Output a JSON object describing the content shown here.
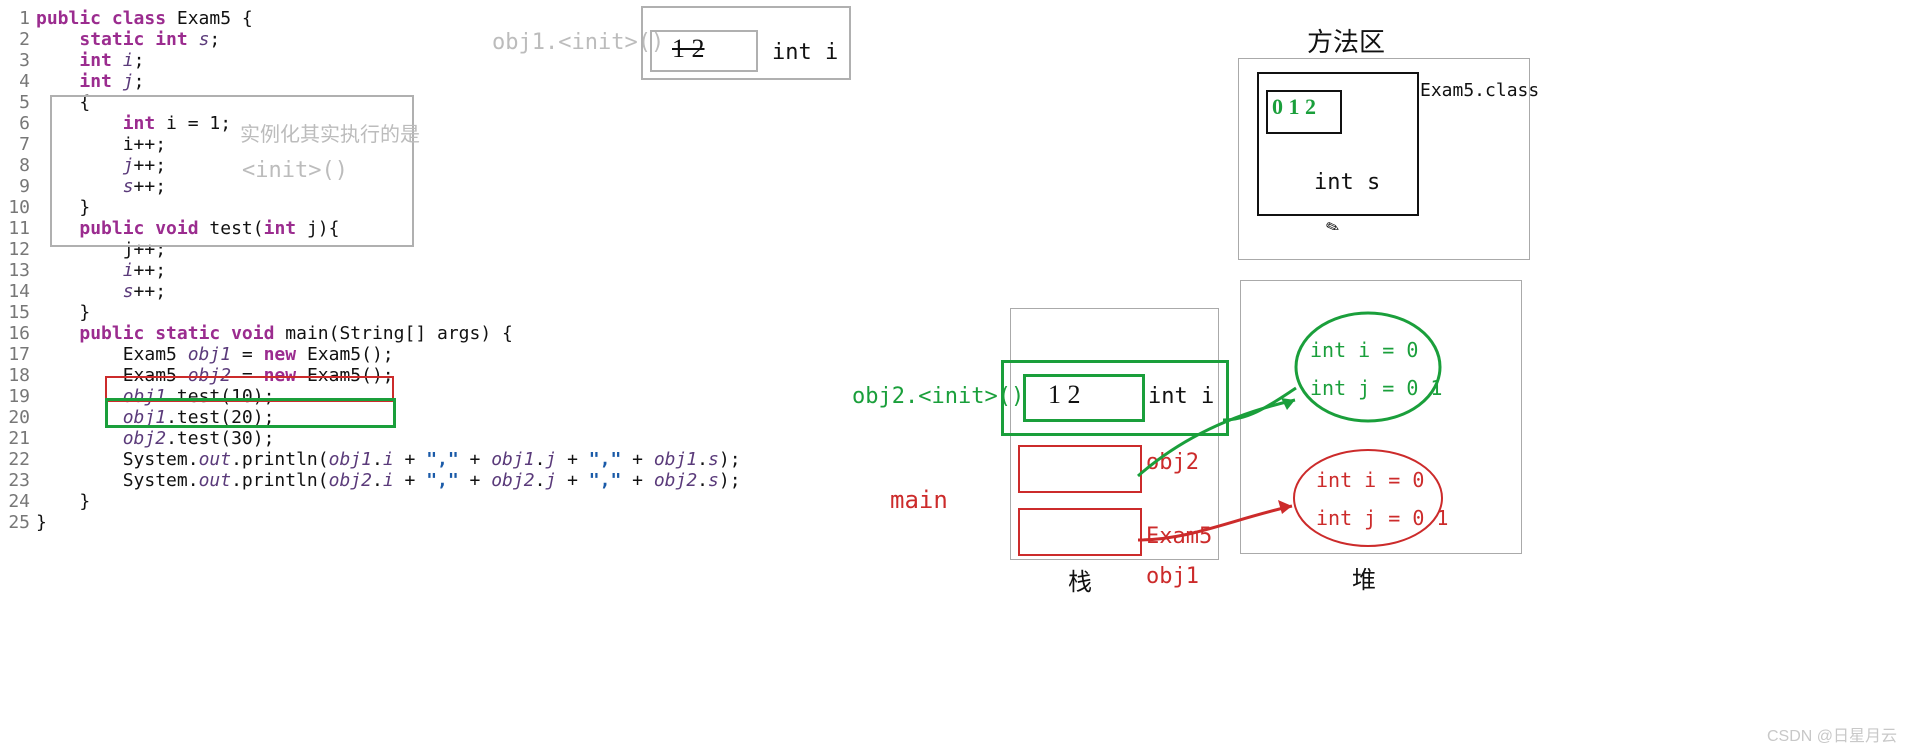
{
  "code": {
    "lines": [
      {
        "n": "1",
        "seg": [
          {
            "c": "kw",
            "t": "public class"
          },
          {
            "c": "txt",
            "t": " Exam5 {"
          }
        ]
      },
      {
        "n": "2",
        "seg": [
          {
            "c": "txt",
            "t": "    "
          },
          {
            "c": "kw",
            "t": "static int"
          },
          {
            "c": "txt",
            "t": " "
          },
          {
            "c": "id",
            "t": "s"
          },
          {
            "c": "txt",
            "t": ";"
          }
        ]
      },
      {
        "n": "3",
        "seg": [
          {
            "c": "txt",
            "t": "    "
          },
          {
            "c": "kw",
            "t": "int"
          },
          {
            "c": "txt",
            "t": " "
          },
          {
            "c": "id",
            "t": "i"
          },
          {
            "c": "txt",
            "t": ";"
          }
        ]
      },
      {
        "n": "4",
        "seg": [
          {
            "c": "txt",
            "t": "    "
          },
          {
            "c": "kw",
            "t": "int"
          },
          {
            "c": "txt",
            "t": " "
          },
          {
            "c": "id",
            "t": "j"
          },
          {
            "c": "txt",
            "t": ";"
          }
        ]
      },
      {
        "n": "5",
        "seg": [
          {
            "c": "txt",
            "t": "    {"
          }
        ]
      },
      {
        "n": "6",
        "seg": [
          {
            "c": "txt",
            "t": "        "
          },
          {
            "c": "kw",
            "t": "int"
          },
          {
            "c": "txt",
            "t": " i = 1;"
          }
        ]
      },
      {
        "n": "7",
        "seg": [
          {
            "c": "txt",
            "t": "        i++;"
          }
        ]
      },
      {
        "n": "8",
        "seg": [
          {
            "c": "txt",
            "t": "        "
          },
          {
            "c": "id",
            "t": "j"
          },
          {
            "c": "txt",
            "t": "++;"
          }
        ]
      },
      {
        "n": "9",
        "seg": [
          {
            "c": "txt",
            "t": "        "
          },
          {
            "c": "id",
            "t": "s"
          },
          {
            "c": "txt",
            "t": "++;"
          }
        ]
      },
      {
        "n": "10",
        "seg": [
          {
            "c": "txt",
            "t": "    }"
          }
        ]
      },
      {
        "n": "11",
        "seg": [
          {
            "c": "txt",
            "t": "    "
          },
          {
            "c": "kw",
            "t": "public void"
          },
          {
            "c": "txt",
            "t": " test("
          },
          {
            "c": "kw",
            "t": "int"
          },
          {
            "c": "txt",
            "t": " j){"
          }
        ]
      },
      {
        "n": "12",
        "seg": [
          {
            "c": "txt",
            "t": "        j++;"
          }
        ]
      },
      {
        "n": "13",
        "seg": [
          {
            "c": "txt",
            "t": "        "
          },
          {
            "c": "id",
            "t": "i"
          },
          {
            "c": "txt",
            "t": "++;"
          }
        ]
      },
      {
        "n": "14",
        "seg": [
          {
            "c": "txt",
            "t": "        "
          },
          {
            "c": "id",
            "t": "s"
          },
          {
            "c": "txt",
            "t": "++;"
          }
        ]
      },
      {
        "n": "15",
        "seg": [
          {
            "c": "txt",
            "t": "    }"
          }
        ]
      },
      {
        "n": "16",
        "seg": [
          {
            "c": "txt",
            "t": "    "
          },
          {
            "c": "kw",
            "t": "public static void"
          },
          {
            "c": "txt",
            "t": " main(String[] args) {"
          }
        ]
      },
      {
        "n": "17",
        "seg": [
          {
            "c": "txt",
            "t": "        Exam5 "
          },
          {
            "c": "id",
            "t": "obj1"
          },
          {
            "c": "txt",
            "t": " = "
          },
          {
            "c": "kw",
            "t": "new"
          },
          {
            "c": "txt",
            "t": " Exam5();"
          }
        ]
      },
      {
        "n": "18",
        "seg": [
          {
            "c": "txt",
            "t": "        Exam5 "
          },
          {
            "c": "id",
            "t": "obj2"
          },
          {
            "c": "txt",
            "t": " = "
          },
          {
            "c": "kw",
            "t": "new"
          },
          {
            "c": "txt",
            "t": " Exam5();"
          }
        ]
      },
      {
        "n": "19",
        "seg": [
          {
            "c": "txt",
            "t": "        "
          },
          {
            "c": "id",
            "t": "obj1"
          },
          {
            "c": "txt",
            "t": ".test(10);"
          }
        ]
      },
      {
        "n": "20",
        "seg": [
          {
            "c": "txt",
            "t": "        "
          },
          {
            "c": "id",
            "t": "obj1"
          },
          {
            "c": "txt",
            "t": ".test(20);"
          }
        ]
      },
      {
        "n": "21",
        "seg": [
          {
            "c": "txt",
            "t": "        "
          },
          {
            "c": "id",
            "t": "obj2"
          },
          {
            "c": "txt",
            "t": ".test(30);"
          }
        ]
      },
      {
        "n": "22",
        "seg": [
          {
            "c": "txt",
            "t": "        System."
          },
          {
            "c": "it id",
            "t": "out"
          },
          {
            "c": "txt",
            "t": ".println("
          },
          {
            "c": "id",
            "t": "obj1"
          },
          {
            "c": "txt",
            "t": "."
          },
          {
            "c": "id",
            "t": "i"
          },
          {
            "c": "txt",
            "t": " + "
          },
          {
            "c": "str",
            "t": "\",\""
          },
          {
            "c": "txt",
            "t": " + "
          },
          {
            "c": "id",
            "t": "obj1"
          },
          {
            "c": "txt",
            "t": "."
          },
          {
            "c": "id",
            "t": "j"
          },
          {
            "c": "txt",
            "t": " + "
          },
          {
            "c": "str",
            "t": "\",\""
          },
          {
            "c": "txt",
            "t": " + "
          },
          {
            "c": "id",
            "t": "obj1"
          },
          {
            "c": "txt",
            "t": "."
          },
          {
            "c": "id",
            "t": "s"
          },
          {
            "c": "txt",
            "t": ");"
          }
        ]
      },
      {
        "n": "23",
        "seg": [
          {
            "c": "txt",
            "t": "        System."
          },
          {
            "c": "it id",
            "t": "out"
          },
          {
            "c": "txt",
            "t": ".println("
          },
          {
            "c": "id",
            "t": "obj2"
          },
          {
            "c": "txt",
            "t": "."
          },
          {
            "c": "id",
            "t": "i"
          },
          {
            "c": "txt",
            "t": " + "
          },
          {
            "c": "str",
            "t": "\",\""
          },
          {
            "c": "txt",
            "t": " + "
          },
          {
            "c": "id",
            "t": "obj2"
          },
          {
            "c": "txt",
            "t": "."
          },
          {
            "c": "id",
            "t": "j"
          },
          {
            "c": "txt",
            "t": " + "
          },
          {
            "c": "str",
            "t": "\",\""
          },
          {
            "c": "txt",
            "t": " + "
          },
          {
            "c": "id",
            "t": "obj2"
          },
          {
            "c": "txt",
            "t": "."
          },
          {
            "c": "id",
            "t": "s"
          },
          {
            "c": "txt",
            "t": ");"
          }
        ]
      },
      {
        "n": "24",
        "seg": [
          {
            "c": "txt",
            "t": "    }"
          }
        ]
      },
      {
        "n": "25",
        "seg": [
          {
            "c": "txt",
            "t": "}"
          }
        ]
      }
    ]
  },
  "annotations": {
    "grey_init_block_hint_l1": "实例化其实执行的是",
    "grey_init_block_hint_l2": "<init>()",
    "obj1_init_label": "obj1.<init>()",
    "obj1_int_i": "int i",
    "obj1_scratch": "1 2",
    "method_area_title": "方法区",
    "exam5_class": "Exam5.class",
    "method_area_ints": "int s",
    "method_scratch": "0 1 2",
    "obj2_init_label": "obj2.<init>()",
    "obj2_int_i": "int i",
    "obj2_scratch": "1 2",
    "main_label": "main",
    "obj2_label": "obj2",
    "exam5_label": "Exam5",
    "obj1_label": "obj1",
    "stack_label": "栈",
    "heap_label": "堆",
    "heap_obj2_i": "int i = 0",
    "heap_obj2_j": "int j = 0 1",
    "heap_obj1_i": "int i = 0",
    "heap_obj1_j": "int j = 0 1"
  },
  "watermark": "CSDN @日星月云"
}
